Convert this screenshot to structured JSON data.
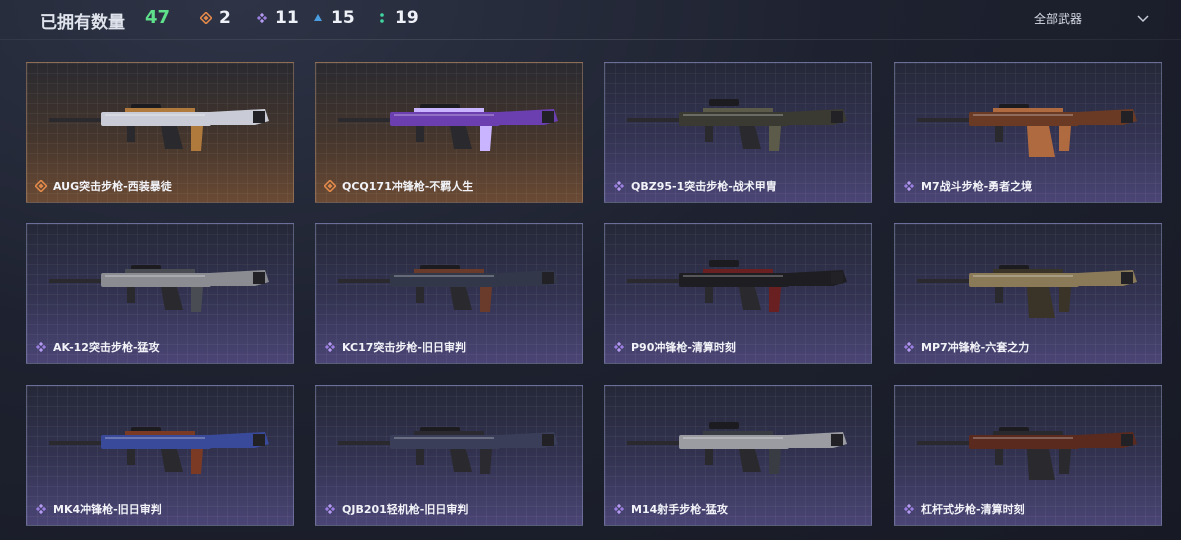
{
  "header": {
    "owned_label": "已拥有数量",
    "owned_count": "47",
    "rarities": [
      {
        "icon": "orange-diamond-icon",
        "count": "2",
        "color": "#e0894a"
      },
      {
        "icon": "purple-diamond-icon",
        "count": "11",
        "color": "#9a7ee0"
      },
      {
        "icon": "blue-triangle-icon",
        "count": "15",
        "color": "#4a9de0"
      },
      {
        "icon": "green-dots-icon",
        "count": "19",
        "color": "#3fd6a0"
      }
    ],
    "filter_label": "全部武器"
  },
  "colors": {
    "owned_count": "#5fe08a",
    "orange_rarity": "#e0894a",
    "purple_rarity": "#9a7ee0"
  },
  "weapons": [
    {
      "name": "AUG突击步枪-西装暴徒",
      "rarity": "orange",
      "body": "#c9ccd6",
      "accent": "#b07a3c"
    },
    {
      "name": "QCQ171冲锋枪-不羁人生",
      "rarity": "orange",
      "body": "#6b3fb0",
      "accent": "#c8b4ff"
    },
    {
      "name": "QBZ95-1突击步枪-战术甲胄",
      "rarity": "purple",
      "body": "#3a3a32",
      "accent": "#5c5a48"
    },
    {
      "name": "M7战斗步枪-勇者之境",
      "rarity": "purple",
      "body": "#6a3a24",
      "accent": "#b06a40"
    },
    {
      "name": "AK-12突击步枪-猛攻",
      "rarity": "purple",
      "body": "#8a8c92",
      "accent": "#4a4c54"
    },
    {
      "name": "KC17突击步枪-旧日审判",
      "rarity": "purple",
      "body": "#33374a",
      "accent": "#6a3a2a"
    },
    {
      "name": "P90冲锋枪-清算时刻",
      "rarity": "purple",
      "body": "#1e1e22",
      "accent": "#6a2020"
    },
    {
      "name": "MP7冲锋枪-六套之力",
      "rarity": "purple",
      "body": "#8a7a58",
      "accent": "#3a3428"
    },
    {
      "name": "MK4冲锋枪-旧日审判",
      "rarity": "purple",
      "body": "#3a4a9a",
      "accent": "#7a3a24"
    },
    {
      "name": "QJB201轻机枪-旧日审判",
      "rarity": "purple",
      "body": "#3a3e58",
      "accent": "#2a2a30"
    },
    {
      "name": "M14射手步枪-猛攻",
      "rarity": "purple",
      "body": "#9a9ca2",
      "accent": "#3a3c44"
    },
    {
      "name": "杠杆式步枪-清算时刻",
      "rarity": "purple",
      "body": "#5a2a1e",
      "accent": "#2a2a2e"
    }
  ]
}
